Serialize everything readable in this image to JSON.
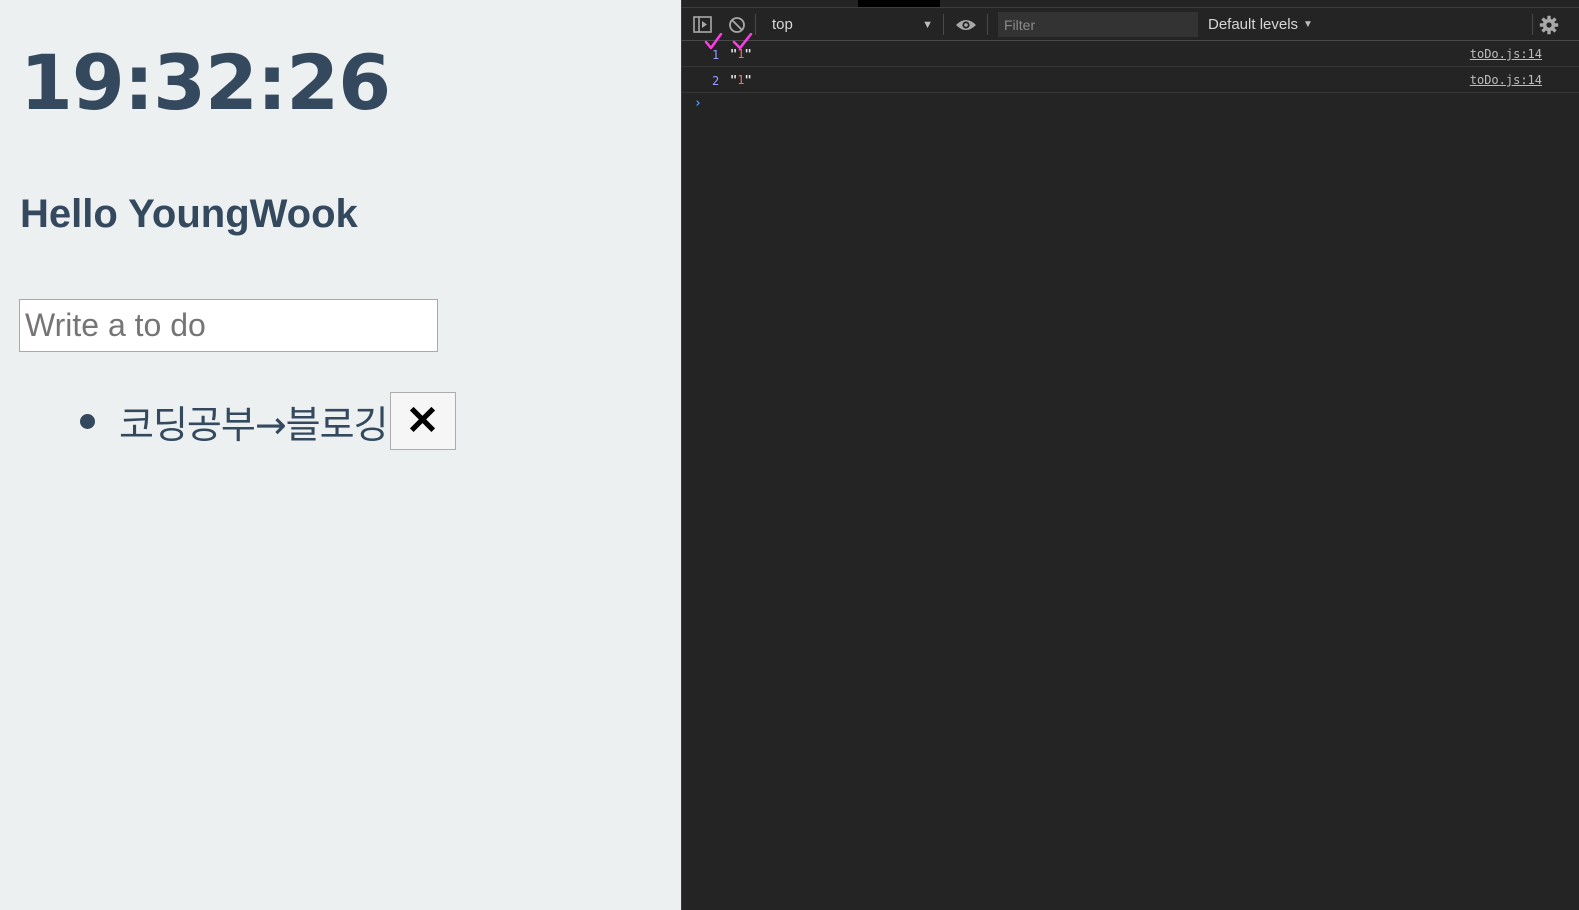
{
  "app": {
    "clock": "19:32:26",
    "greeting": "Hello YoungWook",
    "todo_input": {
      "placeholder": "Write a to do",
      "value": ""
    },
    "todos": [
      {
        "text": "코딩공부→블로깅",
        "delete_label": "✕"
      }
    ]
  },
  "devtools": {
    "context": "top",
    "filter": {
      "placeholder": "Filter",
      "value": ""
    },
    "levels": "Default levels",
    "logs": [
      {
        "count": "1",
        "quote_open": "\"",
        "value": "1",
        "quote_close": "\"",
        "source": "toDo.js:14"
      },
      {
        "count": "2",
        "quote_open": "\"",
        "value": "1",
        "quote_close": "\"",
        "source": "toDo.js:14"
      }
    ],
    "prompt": "›"
  },
  "colors": {
    "app_background": "#ecf0f1",
    "app_text": "#34495e",
    "devtools_background": "#242424",
    "check_annotation": "#ff3ce6"
  },
  "icons": [
    "sidebar-toggle-icon",
    "clear-console-icon",
    "eye-icon",
    "gear-icon",
    "check-annotation-icon"
  ]
}
